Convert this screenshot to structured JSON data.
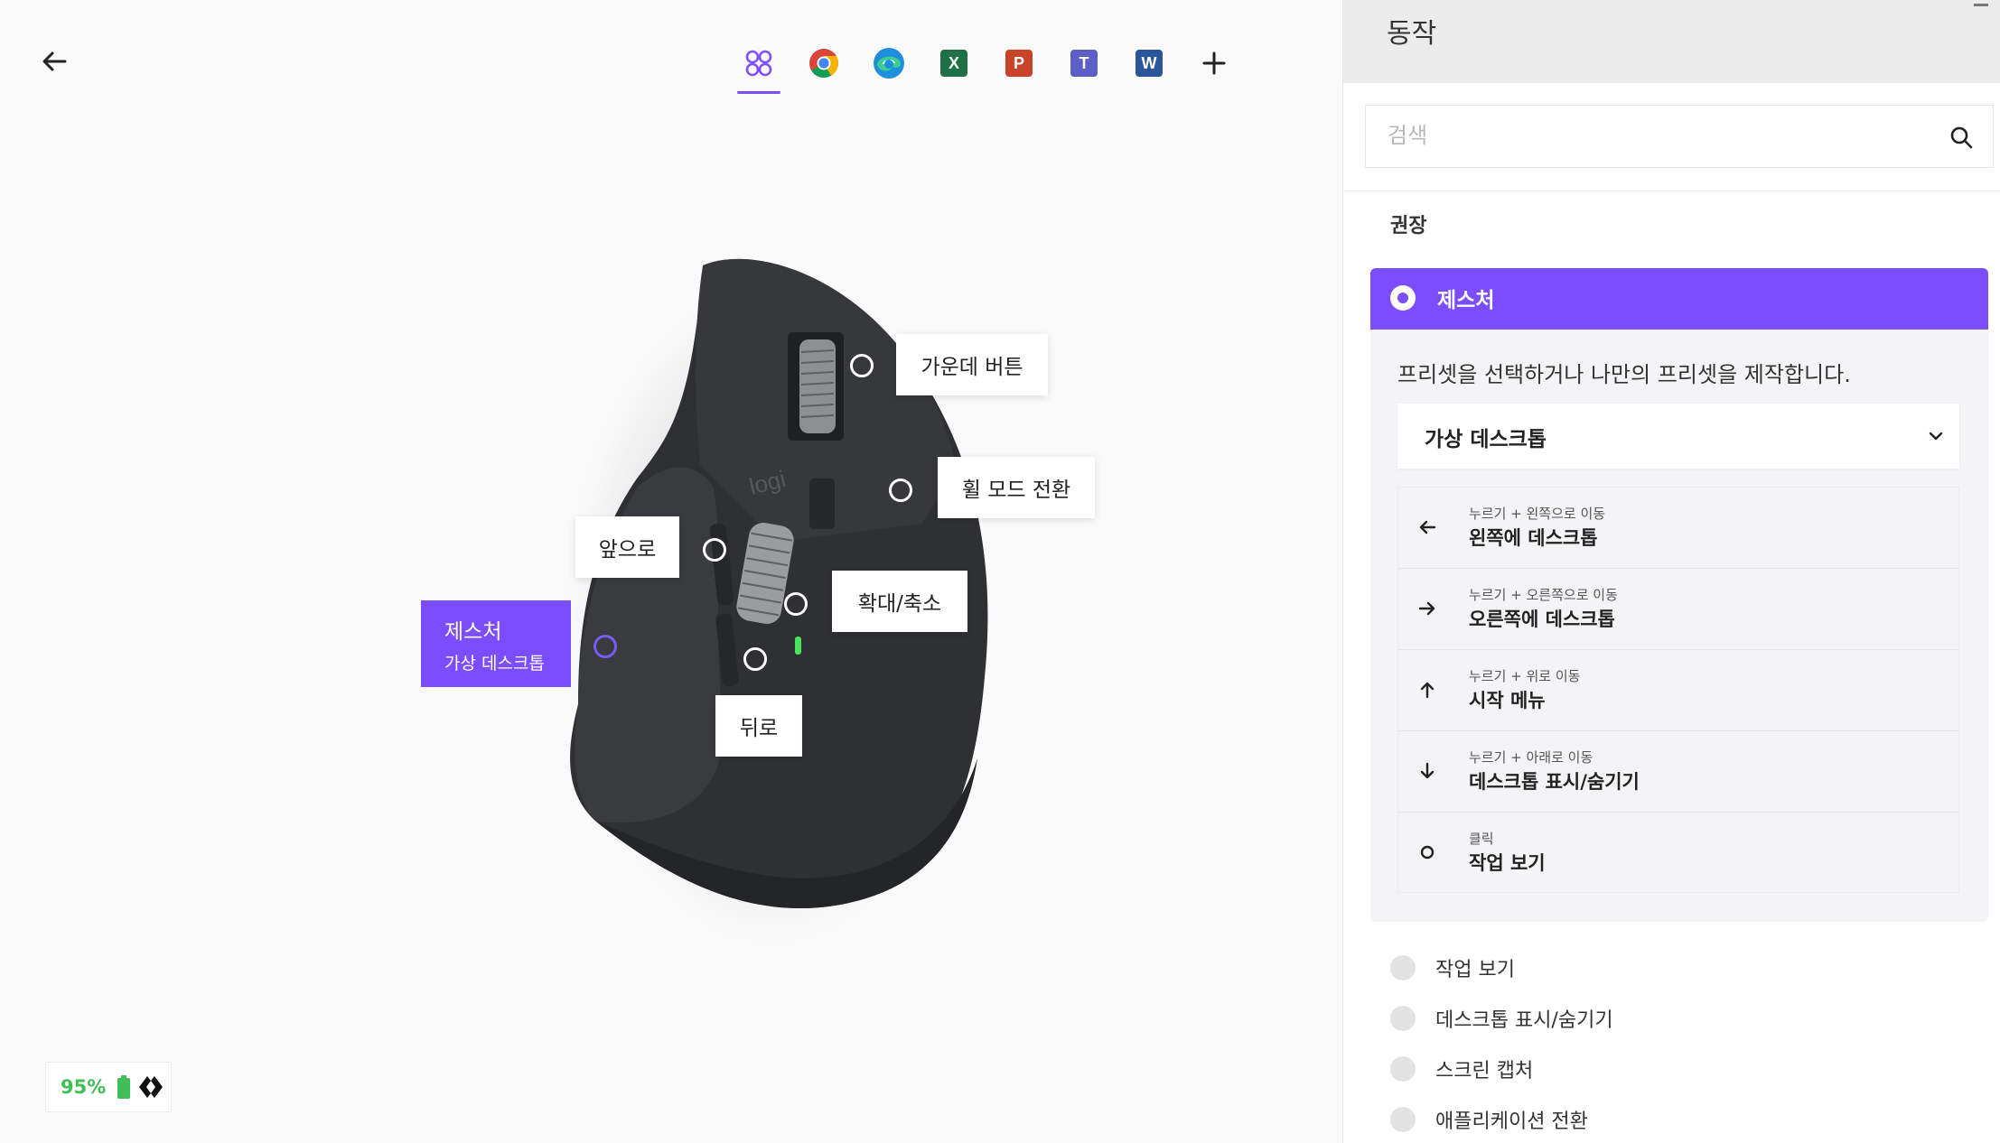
{
  "header": {
    "back_icon": "arrow-left-icon"
  },
  "app_tabs": [
    {
      "name": "all-apps",
      "icon": "four-circles-icon",
      "active": true
    },
    {
      "name": "chrome",
      "icon": "chrome-icon"
    },
    {
      "name": "edge",
      "icon": "edge-icon"
    },
    {
      "name": "excel",
      "icon": "excel-icon",
      "letter": "X"
    },
    {
      "name": "powerpoint",
      "icon": "powerpoint-icon",
      "letter": "P"
    },
    {
      "name": "teams",
      "icon": "teams-icon",
      "letter": "T"
    },
    {
      "name": "word",
      "icon": "word-icon",
      "letter": "W"
    },
    {
      "name": "add-app",
      "icon": "plus-icon"
    }
  ],
  "mouse": {
    "brand": "logi",
    "labels": {
      "middle_button": "가운데 버튼",
      "wheel_mode": "휠 모드 전환",
      "forward": "앞으로",
      "zoom": "확대/축소",
      "back": "뒤로",
      "gesture_title": "제스처",
      "gesture_sub": "가상 데스크톱"
    }
  },
  "battery": {
    "percent": "95%"
  },
  "panel": {
    "title": "동작",
    "search_placeholder": "검색",
    "section_label": "권장",
    "selected_group": {
      "title": "제스처",
      "description": "프리셋을 선택하거나 나만의 프리셋을 제작합니다.",
      "preset": "가상 데스크톱",
      "actions": [
        {
          "hint": "누르기 + 왼쪽으로 이동",
          "name": "왼쪽에 데스크톱",
          "icon": "arrow-left-icon"
        },
        {
          "hint": "누르기 + 오른쪽으로 이동",
          "name": "오른쪽에 데스크톱",
          "icon": "arrow-right-icon"
        },
        {
          "hint": "누르기 + 위로 이동",
          "name": "시작 메뉴",
          "icon": "arrow-up-icon"
        },
        {
          "hint": "누르기 + 아래로 이동",
          "name": "데스크톱 표시/숨기기",
          "icon": "arrow-down-icon"
        },
        {
          "hint": "클릭",
          "name": "작업 보기",
          "icon": "circle-icon"
        }
      ]
    },
    "options": [
      "작업 보기",
      "데스크톱 표시/숨기기",
      "스크린 캡처",
      "애플리케이션 전환"
    ]
  },
  "colors": {
    "accent": "#7c4dff",
    "battery": "#3fbf55",
    "header_bg": "#ececec"
  }
}
